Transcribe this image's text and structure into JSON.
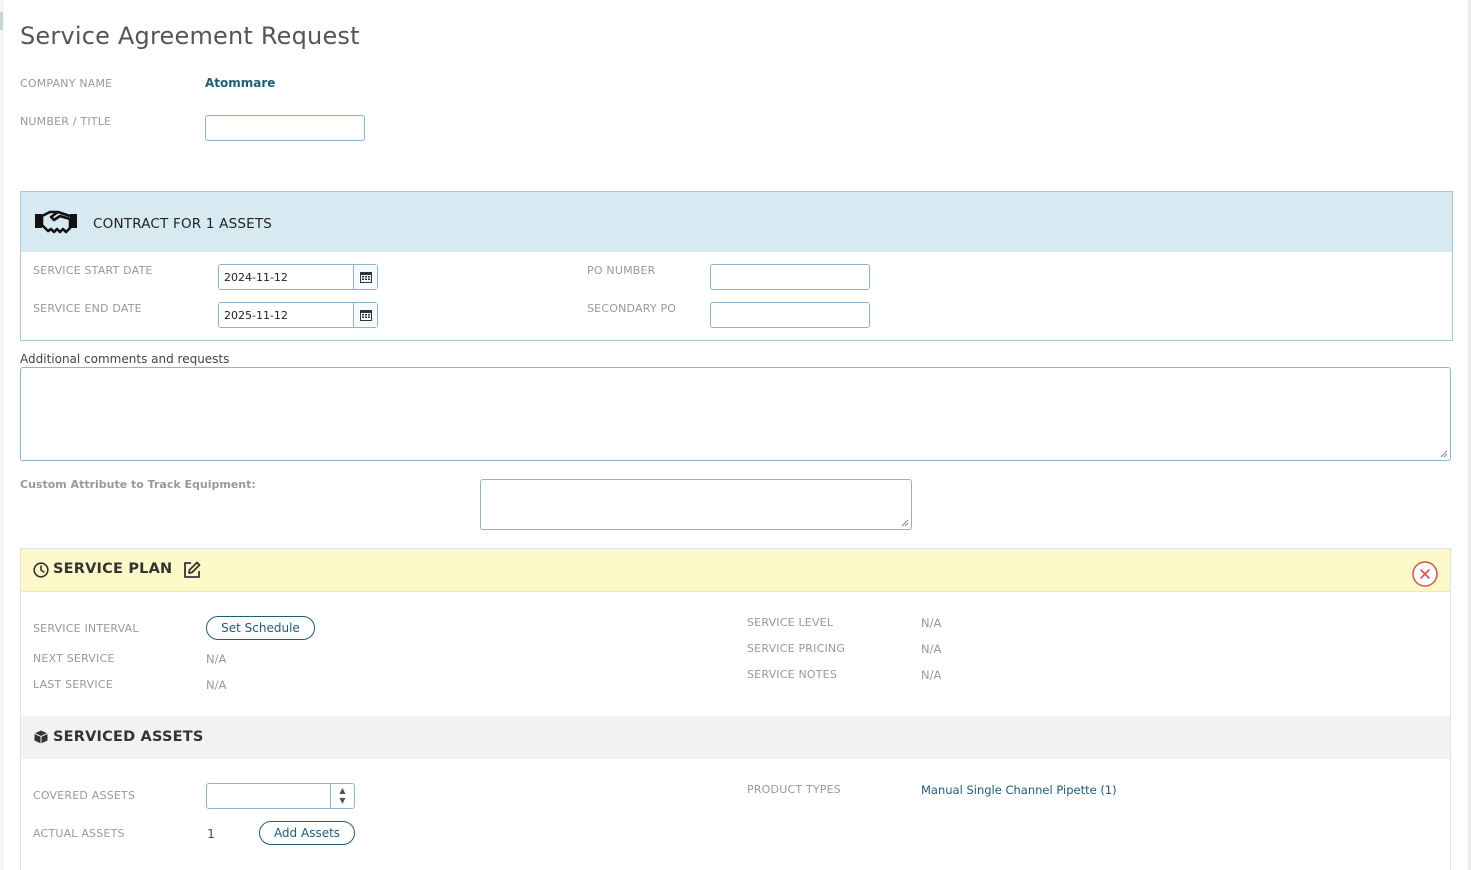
{
  "page": {
    "title": "Service Agreement Request"
  },
  "company": {
    "label": "COMPANY NAME",
    "value": "Atommare"
  },
  "number_title": {
    "label": "NUMBER / TITLE",
    "value": "",
    "placeholder": ""
  },
  "contract": {
    "title": "CONTRACT FOR 1 ASSETS",
    "icon": "handshake-icon",
    "service_start": {
      "label": "SERVICE START DATE",
      "value": "2024-11-12"
    },
    "service_end": {
      "label": "SERVICE END DATE",
      "value": "2025-11-12"
    },
    "po_number": {
      "label": "PO NUMBER",
      "value": ""
    },
    "secondary_po": {
      "label": "SECONDARY PO",
      "value": ""
    }
  },
  "comments": {
    "label": "Additional comments and requests",
    "value": ""
  },
  "custom_attribute": {
    "label": "Custom Attribute to Track Equipment:",
    "value": ""
  },
  "service_plan": {
    "title": "SERVICE PLAN",
    "interval": {
      "label": "SERVICE INTERVAL",
      "button": "Set Schedule"
    },
    "next_service": {
      "label": "NEXT SERVICE",
      "value": "N/A"
    },
    "last_service": {
      "label": "LAST SERVICE",
      "value": "N/A"
    },
    "service_level": {
      "label": "SERVICE LEVEL",
      "value": "N/A"
    },
    "service_pricing": {
      "label": "SERVICE PRICING",
      "value": "N/A"
    },
    "service_notes": {
      "label": "SERVICE NOTES",
      "value": "N/A"
    }
  },
  "serviced_assets": {
    "title": "SERVICED ASSETS",
    "covered_assets": {
      "label": "COVERED ASSETS",
      "value": ""
    },
    "actual_assets": {
      "label": "ACTUAL ASSETS",
      "value": "1",
      "button": "Add Assets"
    },
    "product_types": {
      "label": "PRODUCT TYPES",
      "value": "Manual Single Channel Pipette (1)"
    }
  },
  "colors": {
    "accent": "#1b5e7a",
    "contract_header_bg": "#d7e9f1",
    "plan_header_bg": "#fdf9c8",
    "close_icon": "#d9534f"
  }
}
